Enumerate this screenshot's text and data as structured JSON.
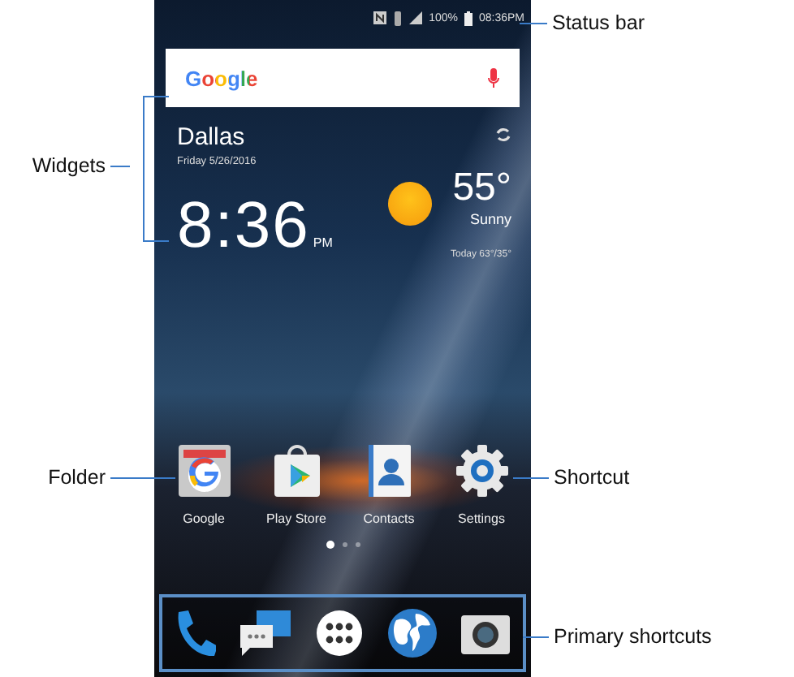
{
  "status_bar": {
    "battery": "100%",
    "time": "08:36PM"
  },
  "search_widget": {
    "logo": "Google"
  },
  "weather_widget": {
    "city": "Dallas",
    "date": "Friday 5/26/2016",
    "time": "8:36",
    "meridiem": "PM",
    "temperature": "55°",
    "condition": "Sunny",
    "forecast": "Today 63°/35°"
  },
  "home_apps": [
    {
      "label": "Google",
      "kind": "folder"
    },
    {
      "label": "Play Store",
      "kind": "store"
    },
    {
      "label": "Contacts",
      "kind": "contacts"
    },
    {
      "label": "Settings",
      "kind": "settings"
    }
  ],
  "page_dots": [
    {
      "selected": true
    },
    {
      "selected": false
    },
    {
      "selected": false
    }
  ],
  "dock": [
    {
      "kind": "phone"
    },
    {
      "kind": "messages"
    },
    {
      "kind": "apps"
    },
    {
      "kind": "browser"
    },
    {
      "kind": "camera"
    }
  ],
  "callouts": [
    {
      "label": "Status bar",
      "kind": "status"
    },
    {
      "label": "Widgets",
      "kind": "widgets"
    },
    {
      "label": "Folder",
      "kind": "folder"
    },
    {
      "label": "Shortcut",
      "kind": "shortcut"
    },
    {
      "label": "Primary shortcuts",
      "kind": "dock"
    }
  ]
}
